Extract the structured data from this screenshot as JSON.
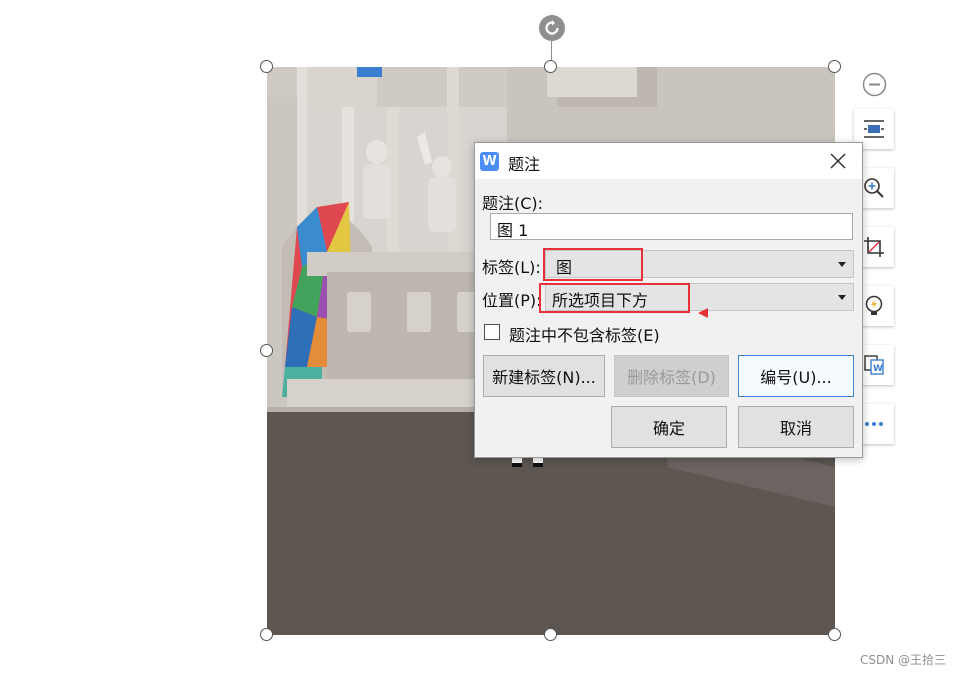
{
  "dialog": {
    "title": "题注",
    "logo_letter": "W",
    "caption_label": "题注(C):",
    "caption_value": "图 1",
    "label_label": "标签(L):",
    "label_value": "图",
    "position_label": "位置(P):",
    "position_value": "所选项目下方",
    "exclude_label_checkbox": "题注中不包含标签(E)",
    "exclude_label_checked": false,
    "buttons": {
      "new_label": "新建标签(N)...",
      "delete_label": "删除标签(D)",
      "numbering": "编号(U)...",
      "ok": "确定",
      "cancel": "取消"
    }
  },
  "side_toolbar": {
    "items": [
      "collapse-icon",
      "text-wrap-icon",
      "zoom-icon",
      "crop-icon",
      "smart-icon",
      "convert-word-icon",
      "more-icon"
    ]
  },
  "colors": {
    "highlight": "#e5323a",
    "accent": "#4b8ef7"
  },
  "watermark": "CSDN @王拾三"
}
